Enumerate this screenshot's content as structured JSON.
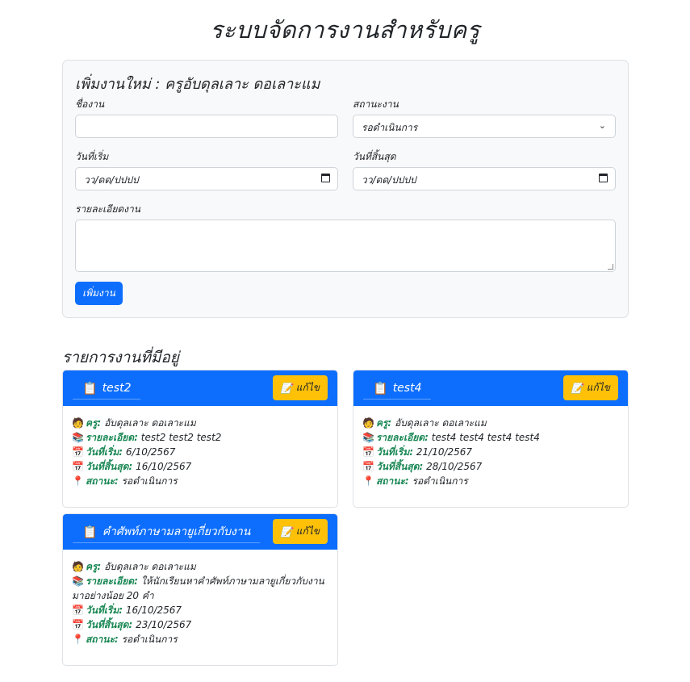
{
  "page": {
    "title": "ระบบจัดการงานสำหรับครู"
  },
  "form": {
    "heading": "เพิ่มงานใหม่ : ครูอับดุลเลาะ ดอเลาะแม",
    "task_name_label": "ชื่องาน",
    "task_name_value": "",
    "status_label": "สถานะงาน",
    "status_value": "รอดำเนินการ",
    "start_label": "วันที่เริ่ม",
    "start_placeholder": "วว/ดด/ปปปป",
    "end_label": "วันที่สิ้นสุด",
    "end_placeholder": "วว/ดด/ปปปป",
    "detail_label": "รายละเอียดงาน",
    "detail_value": "",
    "submit_label": "เพิ่มงาน"
  },
  "list": {
    "title": "รายการงานที่มีอยู่",
    "edit_label": "แก้ไข",
    "labels": {
      "teacher": "ครู:",
      "detail": "รายละเอียด:",
      "start": "วันที่เริ่ม:",
      "end": "วันที่สิ้นสุด:",
      "status": "สถานะ:"
    },
    "tasks": [
      {
        "title": "test2",
        "teacher": "อับดุลเลาะ ดอเลาะแม",
        "detail": "test2 test2 test2",
        "start": "6/10/2567",
        "end": "16/10/2567",
        "status": "รอดำเนินการ"
      },
      {
        "title": "test4",
        "teacher": "อับดุลเลาะ ดอเลาะแม",
        "detail": "test4 test4 test4 test4",
        "start": "21/10/2567",
        "end": "28/10/2567",
        "status": "รอดำเนินการ"
      },
      {
        "title": "คำศัพท์ภาษามลายูเกี่ยวกับงาน",
        "teacher": "อับดุลเลาะ ดอเลาะแม",
        "detail": "ให้นักเรียนหาคำศัพท์ภาษามลายูเกี่ยวกับงานมาอย่างน้อย 20 คำ",
        "start": "16/10/2567",
        "end": "23/10/2567",
        "status": "รอดำเนินการ"
      }
    ]
  },
  "icons": {
    "clipboard": "clipboard-icon",
    "edit": "memo-icon",
    "teacher": "person-icon",
    "detail": "books-icon",
    "calendar": "calendar-icon",
    "status": "pin-icon"
  },
  "colors": {
    "primary": "#0d6efd",
    "warning": "#ffc107",
    "label_green": "#198754",
    "panel_bg": "#f8f9fa"
  }
}
